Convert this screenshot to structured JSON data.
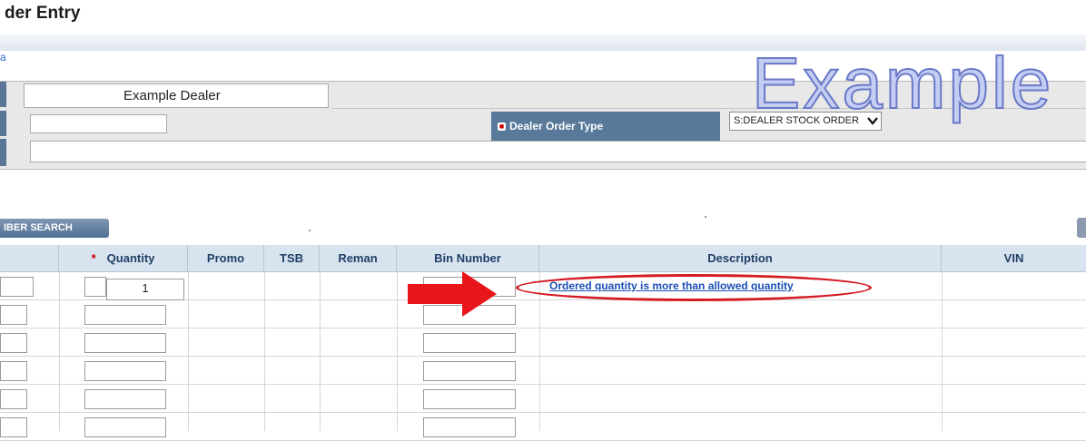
{
  "page": {
    "title": "der Entry"
  },
  "header": {
    "link_text": "a"
  },
  "watermark": {
    "text": "Example"
  },
  "form": {
    "dealer_name": "Example Dealer",
    "small_field_value": "",
    "order_type_label": "Dealer Order Type",
    "order_type_required_mark": "■",
    "order_type_value": "S:DEALER STOCK ORDER",
    "order_type_arrow": "❯",
    "wide_field_value": ""
  },
  "toolbar": {
    "search_label": "IBER SEARCH"
  },
  "grid": {
    "columns": [
      "Quantity",
      "Promo",
      "TSB",
      "Reman",
      "Bin Number",
      "Description",
      "VIN"
    ],
    "quantity_required_mark": "*",
    "rows": [
      {
        "quantity": "1",
        "description": "Ordered quantity is more than allowed quantity"
      },
      {
        "quantity": "",
        "description": ""
      },
      {
        "quantity": "",
        "description": ""
      },
      {
        "quantity": "",
        "description": ""
      },
      {
        "quantity": "",
        "description": ""
      },
      {
        "quantity": "",
        "description": ""
      }
    ]
  },
  "annotations": {
    "arrow_color": "#e8161a",
    "circle_color": "#d31c22"
  },
  "colors": {
    "label_bg": "#58799a",
    "header_bg": "#d8e3f0",
    "header_text": "#1f3f66",
    "link": "#1b4fb5"
  }
}
